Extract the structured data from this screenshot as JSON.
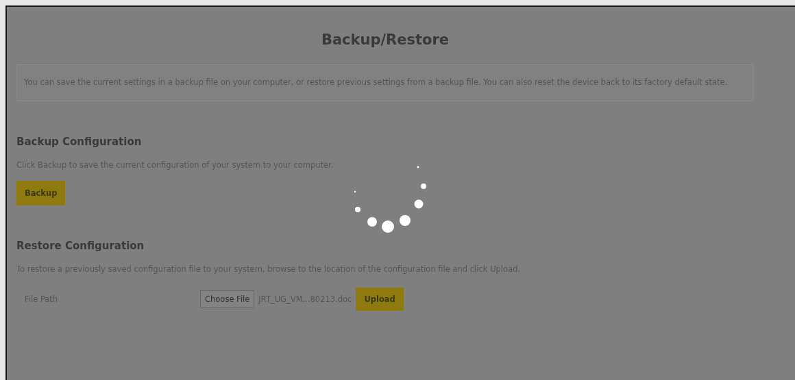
{
  "title": "Backup/Restore",
  "info": "You can save the current settings in a backup file on your computer, or restore previous settings from a backup file. You can also reset the device back to its factory default state.",
  "backup": {
    "heading": "Backup Configuration",
    "description": "Click Backup to save the current configuration of your system to your computer.",
    "button": "Backup"
  },
  "restore": {
    "heading": "Restore Configuration",
    "description": "To restore a previously saved configuration file to your system, browse to the location of the configuration file and click Upload.",
    "file_label": "File Path",
    "choose_button": "Choose File",
    "file_name": "JRT_UG_VM...80213.doc",
    "upload_button": "Upload"
  },
  "loading": true
}
